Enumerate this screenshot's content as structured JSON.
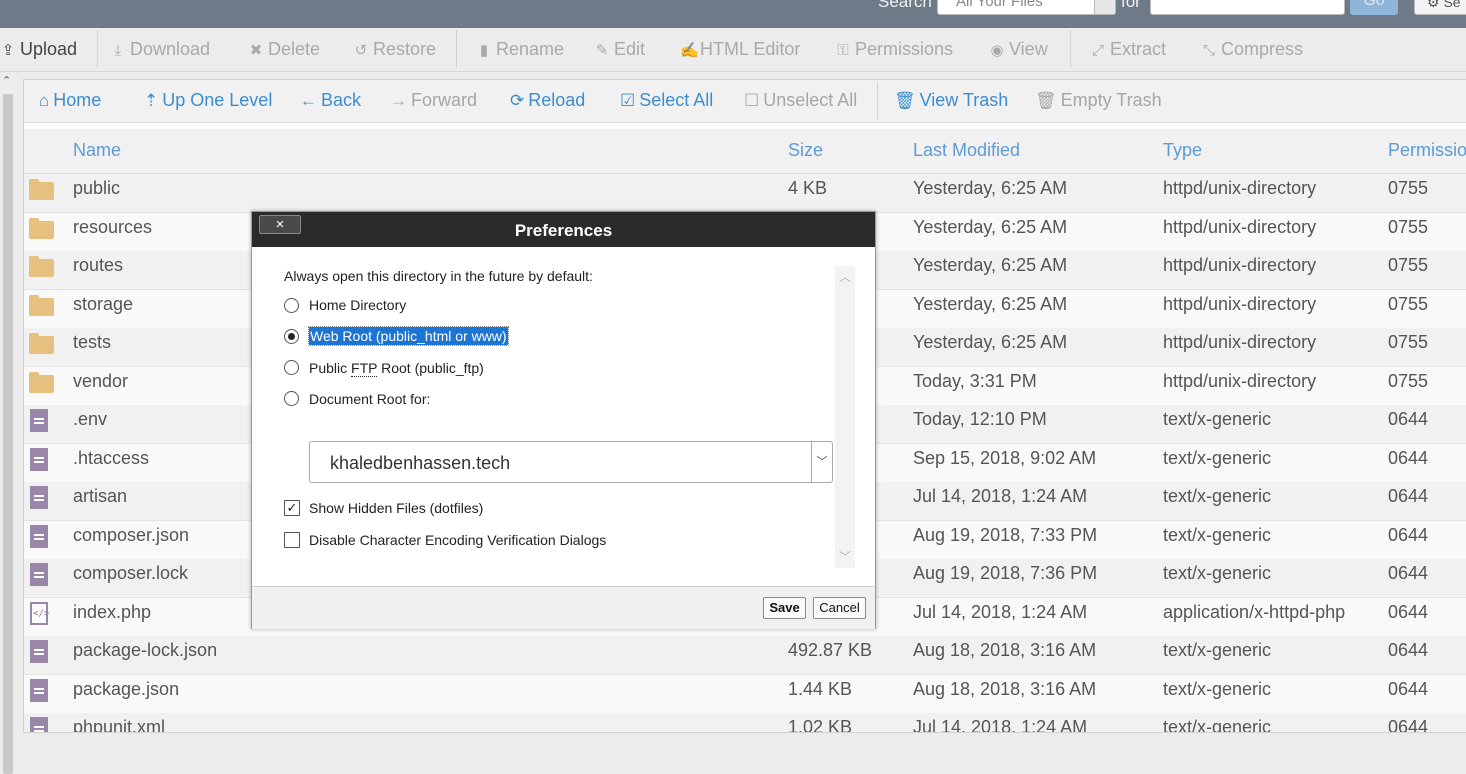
{
  "topbar": {
    "search_label": "Search",
    "search_scope": "All Your Files",
    "for_label": "for",
    "go_label": "Go",
    "settings_label": "Se"
  },
  "toolbar": {
    "upload": "Upload",
    "download": "Download",
    "delete": "Delete",
    "restore": "Restore",
    "rename": "Rename",
    "edit": "Edit",
    "html_editor": "HTML Editor",
    "permissions": "Permissions",
    "view": "View",
    "extract": "Extract",
    "compress": "Compress"
  },
  "nav": {
    "home": "Home",
    "up_one_level": "Up One Level",
    "back": "Back",
    "forward": "Forward",
    "reload": "Reload",
    "select_all": "Select All",
    "unselect_all": "Unselect All",
    "view_trash": "View Trash",
    "empty_trash": "Empty Trash"
  },
  "table": {
    "headers": {
      "name": "Name",
      "size": "Size",
      "last_modified": "Last Modified",
      "type": "Type",
      "permissions": "Permissio"
    },
    "rows": [
      {
        "icon": "folder-icon",
        "name": "public",
        "size": "4 KB",
        "modified": "Yesterday, 6:25 AM",
        "type": "httpd/unix-directory",
        "perm": "0755"
      },
      {
        "icon": "folder-icon",
        "name": "resources",
        "size": "",
        "modified": "Yesterday, 6:25 AM",
        "type": "httpd/unix-directory",
        "perm": "0755"
      },
      {
        "icon": "folder-icon",
        "name": "routes",
        "size": "",
        "modified": "Yesterday, 6:25 AM",
        "type": "httpd/unix-directory",
        "perm": "0755"
      },
      {
        "icon": "folder-icon",
        "name": "storage",
        "size": "",
        "modified": "Yesterday, 6:25 AM",
        "type": "httpd/unix-directory",
        "perm": "0755"
      },
      {
        "icon": "folder-icon",
        "name": "tests",
        "size": "",
        "modified": "Yesterday, 6:25 AM",
        "type": "httpd/unix-directory",
        "perm": "0755"
      },
      {
        "icon": "folder-icon",
        "name": "vendor",
        "size": "",
        "modified": "Today, 3:31 PM",
        "type": "httpd/unix-directory",
        "perm": "0755"
      },
      {
        "icon": "file-icon",
        "name": ".env",
        "size": "",
        "modified": "Today, 12:10 PM",
        "type": "text/x-generic",
        "perm": "0644"
      },
      {
        "icon": "file-icon",
        "name": ".htaccess",
        "size": "",
        "modified": "Sep 15, 2018, 9:02 AM",
        "type": "text/x-generic",
        "perm": "0644"
      },
      {
        "icon": "file-icon",
        "name": "artisan",
        "size": "",
        "modified": "Jul 14, 2018, 1:24 AM",
        "type": "text/x-generic",
        "perm": "0644"
      },
      {
        "icon": "file-icon",
        "name": "composer.json",
        "size": "",
        "modified": "Aug 19, 2018, 7:33 PM",
        "type": "text/x-generic",
        "perm": "0644"
      },
      {
        "icon": "file-icon",
        "name": "composer.lock",
        "size": "",
        "modified": "Aug 19, 2018, 7:36 PM",
        "type": "text/x-generic",
        "perm": "0644"
      },
      {
        "icon": "php-file-icon",
        "name": "index.php",
        "size": "",
        "modified": "Jul 14, 2018, 1:24 AM",
        "type": "application/x-httpd-php",
        "perm": "0644"
      },
      {
        "icon": "file-icon",
        "name": "package-lock.json",
        "size": "492.87 KB",
        "modified": "Aug 18, 2018, 3:16 AM",
        "type": "text/x-generic",
        "perm": "0644"
      },
      {
        "icon": "file-icon",
        "name": "package.json",
        "size": "1.44 KB",
        "modified": "Aug 18, 2018, 3:16 AM",
        "type": "text/x-generic",
        "perm": "0644"
      },
      {
        "icon": "file-icon",
        "name": "phpunit.xml",
        "size": "1.02 KB",
        "modified": "Jul 14, 2018, 1:24 AM",
        "type": "text/x-generic",
        "perm": "0644"
      }
    ]
  },
  "dialog": {
    "title": "Preferences",
    "close_label": "×",
    "intro": "Always open this directory in the future by default:",
    "options": {
      "home": "Home Directory",
      "webroot": "Web Root (public_html or www)",
      "ftp_pre": "Public ",
      "ftp_abbr": "FTP",
      "ftp_post": " Root (public_ftp)",
      "docroot": "Document Root for:"
    },
    "selected_option": "webroot",
    "domain": "khaledbenhassen.tech",
    "show_hidden": "Show Hidden Files (dotfiles)",
    "show_hidden_checked": true,
    "disable_encoding": "Disable Character Encoding Verification Dialogs",
    "disable_encoding_checked": false,
    "save": "Save",
    "cancel": "Cancel"
  }
}
